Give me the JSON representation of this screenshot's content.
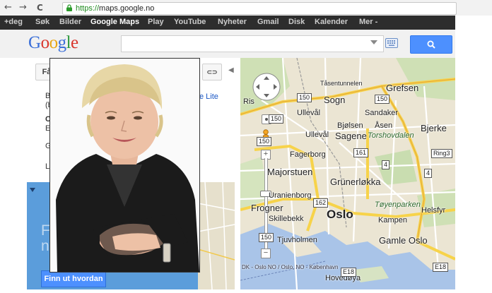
{
  "browser": {
    "back": "←",
    "forward": "→",
    "reload": "C",
    "url_scheme": "https://",
    "url_host": "maps.google.no"
  },
  "gbar": {
    "items": [
      "+deg",
      "Søk",
      "Bilder",
      "Google Maps",
      "Play",
      "YouTube",
      "Nyheter",
      "Gmail",
      "Disk",
      "Kalender",
      "Mer -"
    ]
  },
  "logo": {
    "letters": [
      "G",
      "o",
      "o",
      "g",
      "l",
      "e"
    ]
  },
  "colors": {
    "blue": "#4285f4",
    "red": "#ea4335",
    "yellow": "#fbbc05",
    "green": "#34a853",
    "promo": "#5b9ddb"
  },
  "toolbar": {
    "left_label": "Få",
    "link_icon": "⊂⊃",
    "collapse_icon": "◀"
  },
  "left_fragments": [
    "B",
    "(b",
    "C",
    "E",
    "G",
    "L"
  ],
  "lite_link": "e Lite",
  "promo": {
    "title_part1": "Fa",
    "title_part2": "ny",
    "button": "Finn ut hvordan"
  },
  "map": {
    "labels": {
      "oslo": "Oslo",
      "sagene": "Sagene",
      "sogn": "Sogn",
      "ulleval": "Ullevål",
      "ulleval2": "Ullevål",
      "grunerlokka": "Grünerløkka",
      "majorstuen": "Majorstuen",
      "frogner": "Frogner",
      "grefsen": "Grefsen",
      "bjerke": "Bjerke",
      "torshovdalen": "Torshovdalen",
      "toyenparken": "Tøyenparken",
      "gamle_oslo": "Gamle Oslo",
      "kampen": "Kampen",
      "helsfyr": "Helsfyr",
      "bjolsen": "Bjølsen",
      "asen": "Åsen",
      "sandaker": "Sandaker",
      "fagerborg": "Fagerborg",
      "uranienborg": "Uranienborg",
      "skillebekk": "Skillebekk",
      "tjuvholmen": "Tjuvholmen",
      "hovedoya": "Hovedøya",
      "tasentunnelen": "Tåsentunnelen",
      "ris": "Ris",
      "ferry": "DK - Oslo NO / Oslo, NO - København"
    },
    "shields": [
      "150",
      "150",
      "150",
      "150",
      "161",
      "162",
      "150",
      "Ring3",
      "E18",
      "E18",
      "4",
      "4"
    ]
  }
}
